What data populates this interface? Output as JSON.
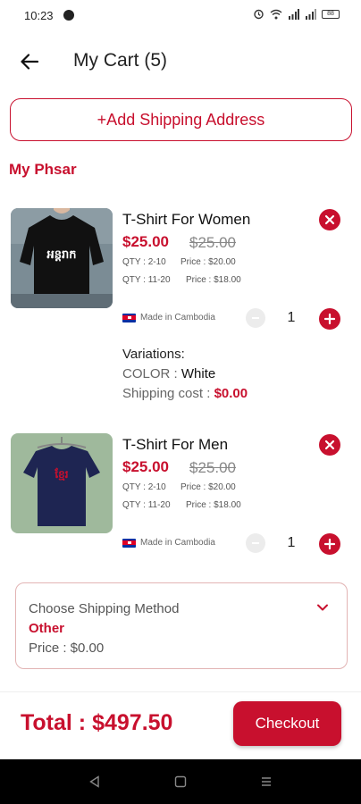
{
  "status_bar": {
    "time": "10:23",
    "battery": "88"
  },
  "header": {
    "title": "My Cart (5)"
  },
  "add_address": {
    "label": "+Add Shipping Address"
  },
  "store": {
    "name": "My Phsar"
  },
  "items": [
    {
      "name": "T-Shirt For Women",
      "price": "$25.00",
      "old_price": "$25.00",
      "tiers": [
        {
          "qty": "QTY : 2-10",
          "price": "Price : $20.00"
        },
        {
          "qty": "QTY : 11-20",
          "price": "Price : $18.00"
        }
      ],
      "origin": "Made in Cambodia",
      "quantity": "1",
      "variations_title": "Variations:",
      "color_label": "COLOR : ",
      "color_value": "White",
      "shipping_label": "Shipping cost : ",
      "shipping_value": "$0.00",
      "image_text": "អន្តរាក",
      "image_bg": "#7b8c95",
      "shirt_color": "#111111"
    },
    {
      "name": "T-Shirt For Men",
      "price": "$25.00",
      "old_price": "$25.00",
      "tiers": [
        {
          "qty": "QTY : 2-10",
          "price": "Price : $20.00"
        },
        {
          "qty": "QTY : 11-20",
          "price": "Price : $18.00"
        }
      ],
      "origin": "Made in Cambodia",
      "quantity": "1",
      "image_text": "ខ្មែរ",
      "image_bg": "#9fb99c",
      "shirt_color": "#1e2552"
    }
  ],
  "shipping_method": {
    "label": "Choose Shipping Method",
    "value": "Other",
    "price": "Price : $0.00"
  },
  "footer": {
    "total": "Total : $497.50",
    "checkout_label": "Checkout"
  },
  "colors": {
    "accent": "#c8102e",
    "text": "#1a1a1a",
    "muted": "#666666"
  },
  "icons": {
    "back": "arrow-left-icon",
    "remove": "close-circle-icon",
    "plus": "plus-icon",
    "minus": "minus-icon",
    "dropdown": "chevron-down-icon",
    "flag": "cambodia-flag-icon"
  }
}
